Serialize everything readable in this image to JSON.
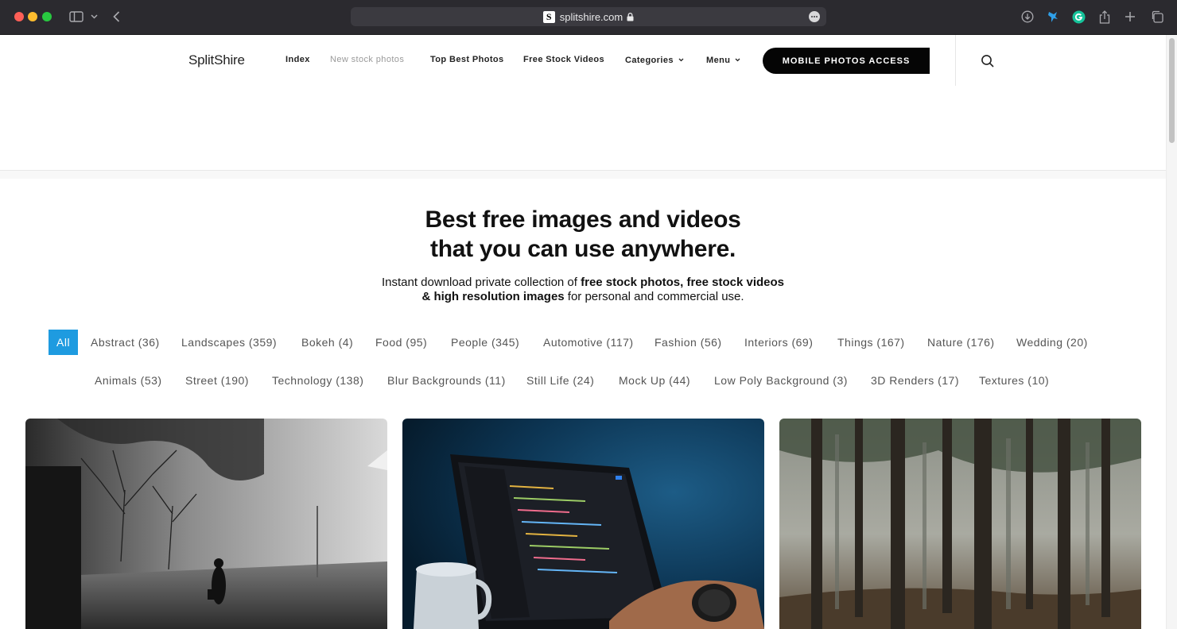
{
  "browser": {
    "url": "splitshire.com",
    "favicon_letter": "S"
  },
  "header": {
    "logo": "SplitShire",
    "nav": [
      {
        "label": "Index",
        "style": "bold"
      },
      {
        "label": "New stock photos",
        "style": "muted"
      },
      {
        "label": "Top Best Photos",
        "style": "bold"
      },
      {
        "label": "Free Stock Videos",
        "style": "bold"
      },
      {
        "label": "Categories",
        "style": "bold",
        "dropdown": true
      },
      {
        "label": "Menu",
        "style": "bold",
        "dropdown": true
      }
    ],
    "cta_label": "MOBILE PHOTOS ACCESS",
    "search_icon": "search-icon"
  },
  "hero": {
    "title_line1": "Best free images and videos",
    "title_line2": "that you can use anywhere.",
    "sub_line1_a": "Instant download private collection of ",
    "sub_line1_b": "free stock photos, free stock videos",
    "sub_line2_a": "& high resolution images",
    "sub_line2_b": " for personal and commercial use."
  },
  "filters": {
    "row1": [
      "All",
      "Abstract (36)",
      "Landscapes (359)",
      "Bokeh (4)",
      "Food (95)",
      "People (345)",
      "Automotive (117)",
      "Fashion (56)",
      "Interiors (69)",
      "Things (167)",
      "Nature (176)",
      "Wedding (20)"
    ],
    "row2": [
      "Animals (53)",
      "Street (190)",
      "Technology (138)",
      "Blur Backgrounds (11)",
      "Still Life (24)",
      "Mock Up (44)",
      "Low Poly Background (3)",
      "3D Renders (17)",
      "Textures (10)"
    ],
    "active": "All",
    "active_color": "#1e9be0"
  },
  "photos": [
    {
      "subject": "foggy-street-walker",
      "tone": "grayscale"
    },
    {
      "subject": "laptop-code-coffee-mug",
      "tone": "dark-blue"
    },
    {
      "subject": "misty-forest",
      "tone": "earth"
    }
  ]
}
